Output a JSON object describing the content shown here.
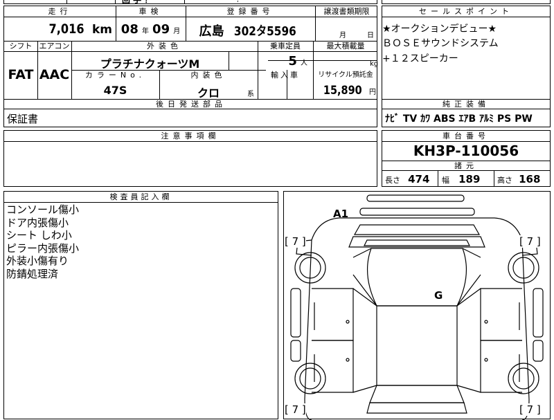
{
  "top_partial": {
    "left_text": "回 手 ？",
    "right_text": "？"
  },
  "headers": {
    "mileage": "走行",
    "inspection": "車検",
    "registration": "登録番号",
    "transfer_deadline": "譲渡書類期限",
    "shift": "シフト",
    "aircon": "エアコン",
    "exterior_color": "外装色",
    "capacity": "乗車定員",
    "max_load": "最大積載量",
    "color_no": "カラーNo.",
    "interior_color": "内装色",
    "import": "輸入車",
    "recycle": "リサイクル預託金",
    "deferred_parts": "後日発送部品",
    "notes": "注意事項欄",
    "sales_points": "セールスポイント",
    "equipment": "純正装備",
    "chassis_no": "車台番号",
    "specs": "諸元",
    "inspector_notes": "検査員記入欄"
  },
  "mileage": {
    "value": "7,016",
    "unit": "km"
  },
  "inspection": {
    "year": "08",
    "year_unit": "年",
    "month": "09",
    "month_unit": "月"
  },
  "registration": {
    "region": "広島",
    "number": "302タ5596"
  },
  "transfer_deadline": {
    "month_unit": "月",
    "day_unit": "日"
  },
  "shift": "FAT",
  "aircon": "AAC",
  "exterior_color": "プラチナクォーツM",
  "capacity": {
    "value": "5",
    "unit": "人"
  },
  "max_load": {
    "value": "",
    "unit": "kg"
  },
  "color_no": "47S",
  "interior_color": {
    "value": "クロ",
    "suffix": "系"
  },
  "recycle": {
    "value": "15,890",
    "unit": "円"
  },
  "deferred_parts": "保証書",
  "sales_points": [
    "★オークションデビュー★",
    "ＢＯＳＥサウンドシステム",
    "+１２スピーカー"
  ],
  "equipment": "ﾅﾋﾞ TV ｶﾜ ABS ｴｱB ｱﾙﾐ PS PW",
  "chassis_no": "KH3P-110056",
  "specs": {
    "length_label": "長さ",
    "length": "474",
    "width_label": "幅",
    "width": "189",
    "height_label": "高さ",
    "height": "168"
  },
  "inspector_notes": [
    "コンソール傷小",
    "ドア内張傷小",
    "シート しわ小",
    "ピラー内張傷小",
    "外装小傷有り",
    "防錆処理済"
  ],
  "diagram": {
    "marks": {
      "a1": "A1",
      "g": "G"
    },
    "tread": "[ 7 ]"
  }
}
